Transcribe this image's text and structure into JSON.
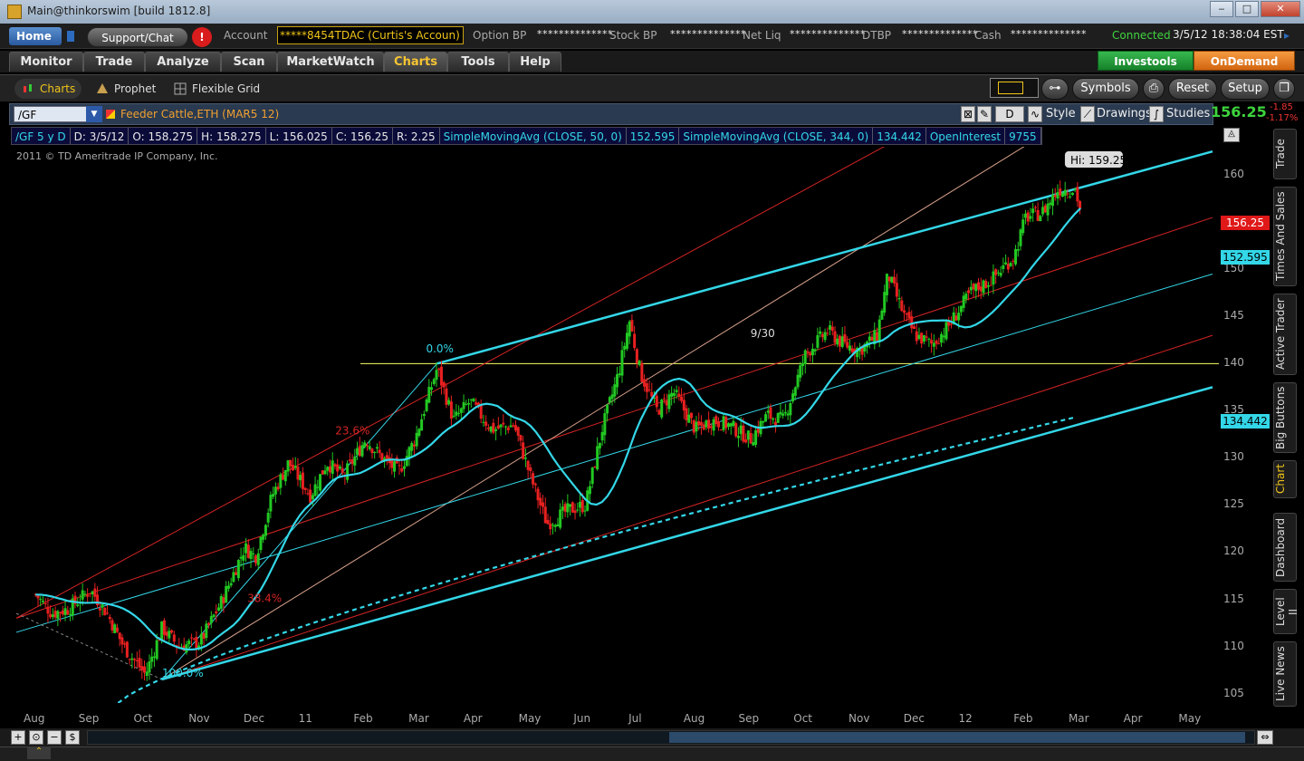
{
  "window": {
    "title": "Main@thinkorswim [build 1812.8]",
    "min": "‒",
    "max": "□",
    "close": "✕"
  },
  "account_bar": {
    "home": "Home",
    "support": "Support/Chat",
    "alert": "!",
    "account_label": "Account",
    "account_value": "*****8454TDAC (Curtis's Accoun)",
    "option_bp_label": "Option BP",
    "option_bp_value": "**************",
    "stock_bp_label": "Stock BP",
    "stock_bp_value": "**************",
    "net_liq_label": "Net Liq",
    "net_liq_value": "**************",
    "dtbp_label": "DTBP",
    "dtbp_value": "**************",
    "cash_label": "Cash",
    "cash_value": "**************",
    "connected": "Connected",
    "clock": "3/5/12 18:38:04 EST",
    "clock_arrow": "▸"
  },
  "main_tabs": [
    "Monitor",
    "Trade",
    "Analyze",
    "Scan",
    "MarketWatch",
    "Charts",
    "Tools",
    "Help"
  ],
  "active_tab": "Charts",
  "investools": "Investools",
  "ondemand": "OnDemand",
  "sub_tabs": [
    "Charts",
    "Prophet",
    "Flexible Grid"
  ],
  "toolbar_buttons": {
    "symbols": "Symbols",
    "reset": "Reset",
    "setup": "Setup"
  },
  "symbol_bar": {
    "symbol": "/GF",
    "name": "Feeder Cattle,ETH (MAR5 12)",
    "period": "D",
    "style": "Style",
    "drawings": "Drawings",
    "studies": "Studies",
    "last": "156.25",
    "change": "-1.85",
    "change_pct": "-1.17%"
  },
  "info_bar": {
    "sym": "/GF 5 y D",
    "date": "D: 3/5/12",
    "open": "O: 158.275",
    "high": "H: 158.275",
    "low": "L: 156.025",
    "close": "C: 156.25",
    "range": "R: 2.25",
    "sma1_label": "SimpleMovingAvg (CLOSE, 50, 0)",
    "sma1_value": "152.595",
    "sma2_label": "SimpleMovingAvg (CLOSE, 344, 0)",
    "sma2_value": "134.442",
    "oi_label": "OpenInterest",
    "oi_value": "9755"
  },
  "copyright": "2011 © TD Ameritrade IP Company, Inc.",
  "annotations": {
    "hi_label": "Hi: 159.25",
    "fib_0": "0.0%",
    "fib_236": "23.6%",
    "fib_384": "38.4%",
    "fib_100": "100.0%",
    "date_930": "9/30"
  },
  "side_tabs": [
    "Trade",
    "Times And Sales",
    "Active Trader",
    "Big Buttons",
    "Chart",
    "Dashboard",
    "Level II",
    "Live News"
  ],
  "active_side_tab": "Chart",
  "colors": {
    "up": "#22c822",
    "down": "#e82020",
    "cyan": "#33d7e8",
    "yellow": "#ffff66",
    "red_line": "#d42424",
    "tan_line": "#d6a08a"
  },
  "chart_data": {
    "type": "candlestick",
    "title": "/GF 5 y D",
    "ylim": [
      104,
      163
    ],
    "y_ticks": [
      105,
      110,
      115,
      120,
      125,
      130,
      135,
      140,
      145,
      150,
      155,
      160
    ],
    "x_ticks": [
      "Aug",
      "Sep",
      "Oct",
      "Nov",
      "Dec",
      "11",
      "Feb",
      "Mar",
      "Apr",
      "May",
      "Jun",
      "Jul",
      "Aug",
      "Sep",
      "Oct",
      "Nov",
      "Dec",
      "12",
      "Feb",
      "Mar",
      "Apr",
      "May"
    ],
    "price_path": [
      [
        0,
        115.5
      ],
      [
        0.3,
        113.5
      ],
      [
        0.6,
        114.0
      ],
      [
        1.0,
        116.0
      ],
      [
        1.3,
        113.5
      ],
      [
        1.6,
        110.0
      ],
      [
        2.0,
        107.0
      ],
      [
        2.3,
        112.0
      ],
      [
        2.6,
        110.0
      ],
      [
        3.0,
        110.5
      ],
      [
        3.4,
        115.0
      ],
      [
        3.8,
        120.5
      ],
      [
        4.0,
        119.5
      ],
      [
        4.3,
        126.0
      ],
      [
        4.6,
        129.5
      ],
      [
        5.0,
        126.0
      ],
      [
        5.3,
        129.5
      ],
      [
        5.6,
        128.0
      ],
      [
        6.0,
        132.0
      ],
      [
        6.3,
        130.0
      ],
      [
        6.6,
        128.5
      ],
      [
        6.9,
        132.0
      ],
      [
        7.3,
        139.5
      ],
      [
        7.6,
        134.0
      ],
      [
        7.9,
        136.0
      ],
      [
        8.3,
        133.0
      ],
      [
        8.7,
        133.5
      ],
      [
        9.0,
        128.0
      ],
      [
        9.3,
        123.0
      ],
      [
        9.7,
        124.5
      ],
      [
        10.0,
        125.0
      ],
      [
        10.3,
        133.0
      ],
      [
        10.6,
        139.0
      ],
      [
        10.8,
        144.5
      ],
      [
        11.0,
        139.0
      ],
      [
        11.3,
        135.0
      ],
      [
        11.6,
        137.0
      ],
      [
        12.0,
        133.0
      ],
      [
        12.3,
        134.0
      ],
      [
        12.6,
        133.5
      ],
      [
        13.0,
        132.0
      ],
      [
        13.3,
        134.5
      ],
      [
        13.6,
        134.0
      ],
      [
        14.0,
        141.0
      ],
      [
        14.4,
        143.5
      ],
      [
        14.7,
        142.0
      ],
      [
        15.0,
        141.5
      ],
      [
        15.3,
        143.0
      ],
      [
        15.5,
        149.5
      ],
      [
        15.8,
        145.0
      ],
      [
        16.0,
        143.0
      ],
      [
        16.3,
        142.0
      ],
      [
        16.6,
        144.0
      ],
      [
        17.0,
        147.5
      ],
      [
        17.4,
        149.0
      ],
      [
        17.8,
        151.5
      ],
      [
        18.0,
        155.5
      ],
      [
        18.3,
        156.0
      ],
      [
        18.6,
        158.5
      ],
      [
        18.9,
        158.5
      ],
      [
        19.0,
        156.25
      ]
    ],
    "sma50_last": 152.595,
    "sma344_last": 134.442,
    "high_marker": 159.25,
    "horizontal_line": 140.0,
    "last_price": 156.25
  }
}
